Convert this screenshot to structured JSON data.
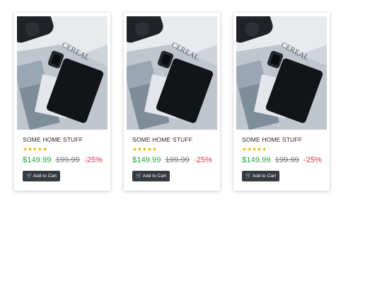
{
  "products": [
    {
      "title": "SOME HOME STUFF",
      "rating": 4.5,
      "rating_max": 5,
      "price": "$149.99",
      "old_price": "199.99",
      "discount": "-25%",
      "button_label": "Add to Cart",
      "button_icon": "shopping-cart-icon",
      "image_alt": "Smartwatch and phone on table"
    },
    {
      "title": "SOME HOME STUFF",
      "rating": 4.5,
      "rating_max": 5,
      "price": "$149.99",
      "old_price": "199.99",
      "discount": "-25%",
      "button_label": "Add to Cart",
      "button_icon": "shopping-cart-icon",
      "image_alt": "Smartwatch and phone on table"
    },
    {
      "title": "SOME HOME STUFF",
      "rating": 4.5,
      "rating_max": 5,
      "price": "$149.99",
      "old_price": "199.99",
      "discount": "-25%",
      "button_label": "Add to Cart",
      "button_icon": "shopping-cart-icon",
      "image_alt": "Smartwatch and phone on table"
    }
  ],
  "colors": {
    "price": "#28a745",
    "old_price": "#6c757d",
    "discount": "#dc3545",
    "star": "#f5b301",
    "button_bg": "#343a40"
  }
}
